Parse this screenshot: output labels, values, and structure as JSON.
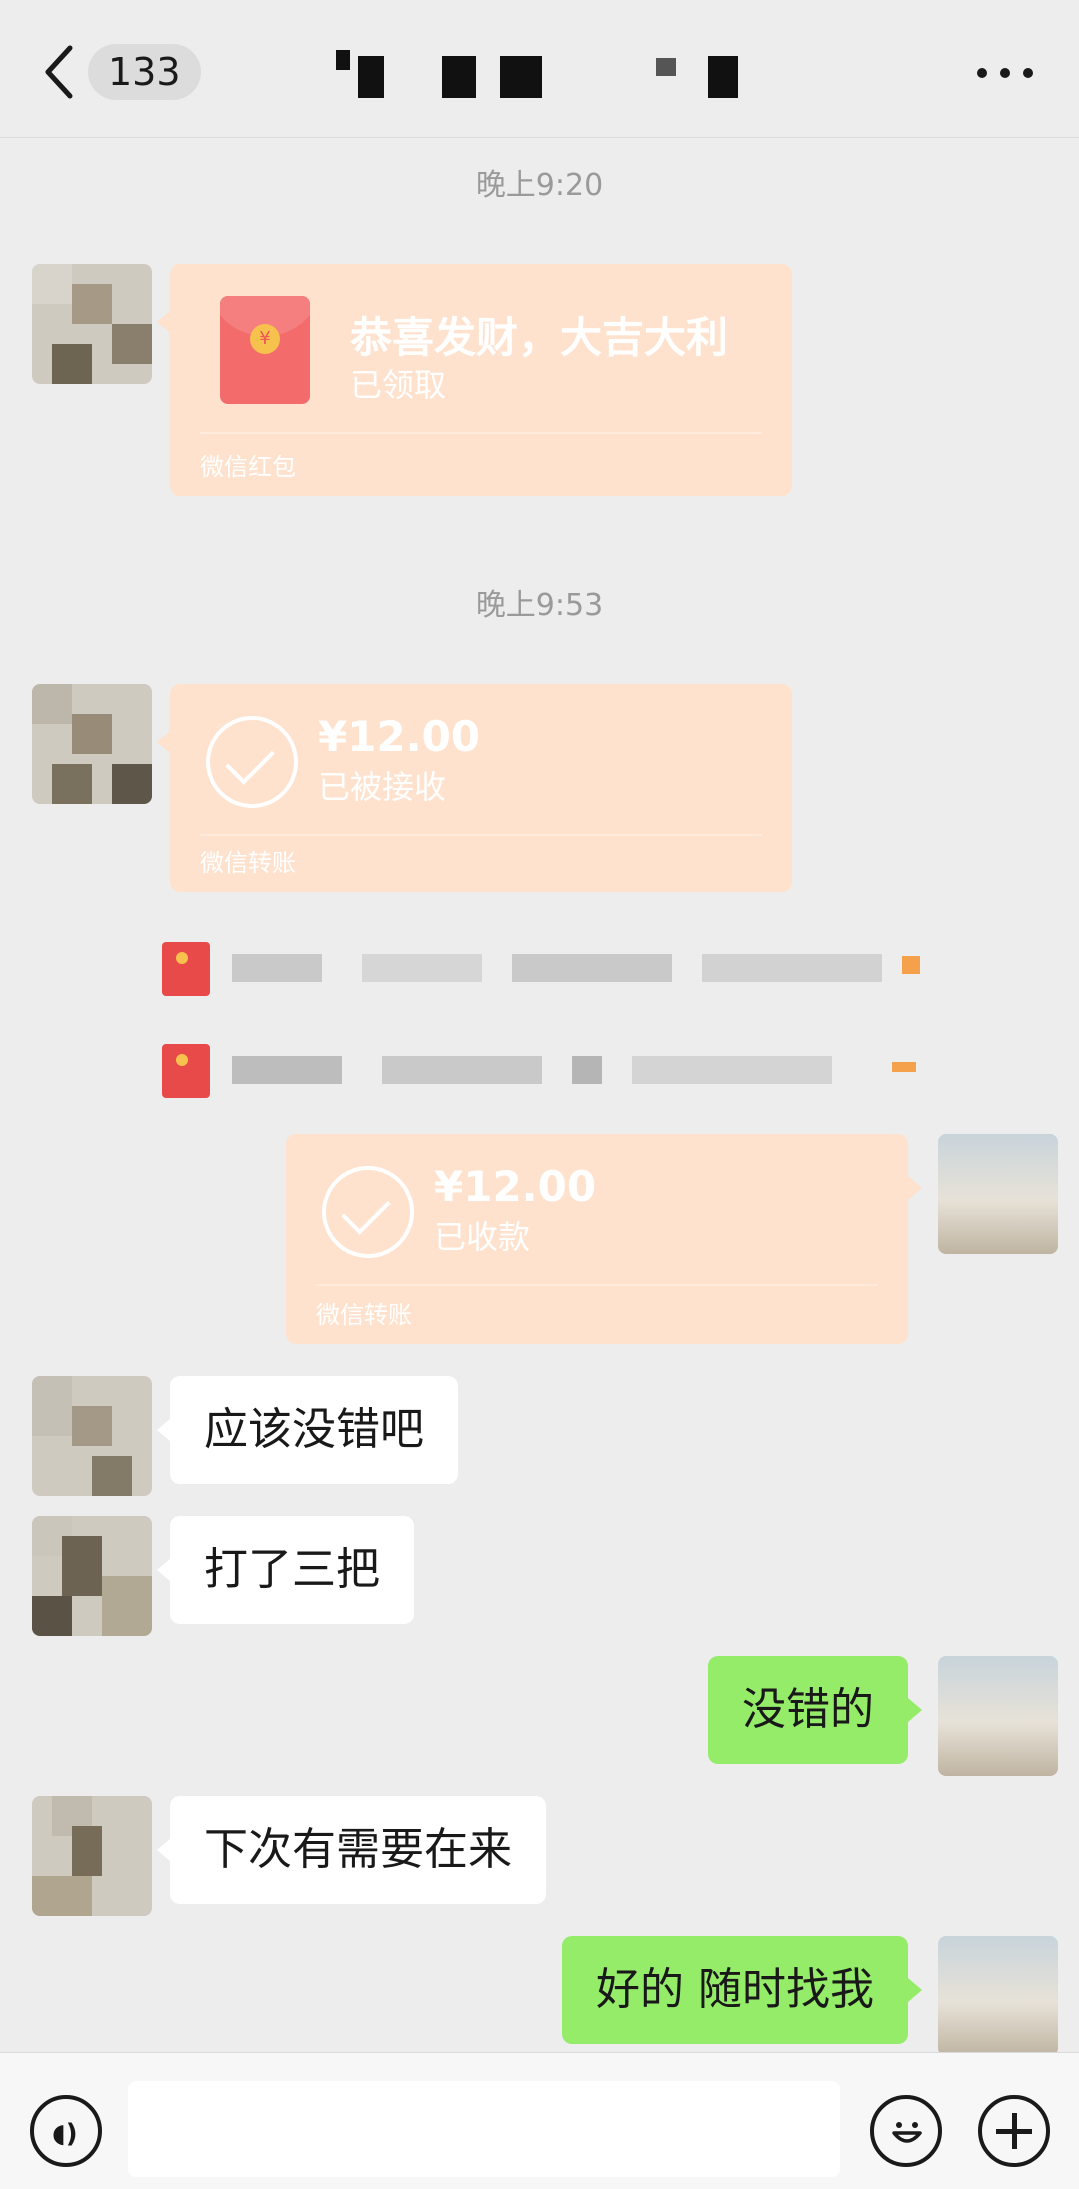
{
  "header": {
    "unread_count": "133",
    "title": ""
  },
  "messages": {
    "time1": "晚上9:20",
    "red_packet": {
      "greeting": "恭喜发财，大吉大利",
      "status": "已领取",
      "footer": "微信红包"
    },
    "time2": "晚上9:53",
    "transfer_in": {
      "amount": "¥12.00",
      "status": "已被接收",
      "footer": "微信转账"
    },
    "transfer_out": {
      "amount": "¥12.00",
      "status": "已收款",
      "footer": "微信转账"
    },
    "texts": [
      {
        "from": "them",
        "text": "应该没错吧"
      },
      {
        "from": "them",
        "text": "打了三把"
      },
      {
        "from": "me",
        "text": "没错的"
      },
      {
        "from": "them",
        "text": "下次有需要在来"
      },
      {
        "from": "me",
        "text": "好的 随时找我"
      }
    ]
  },
  "input": {
    "value": "",
    "placeholder": ""
  },
  "colors": {
    "background": "#ededed",
    "transfer_card": "#ffe2cd",
    "outgoing_bubble": "#95ec69",
    "incoming_bubble": "#ffffff"
  },
  "icons": [
    "back-chevron-icon",
    "more-icon",
    "check-circle-icon",
    "red-packet-icon",
    "voice-icon",
    "emoji-icon",
    "plus-icon"
  ]
}
